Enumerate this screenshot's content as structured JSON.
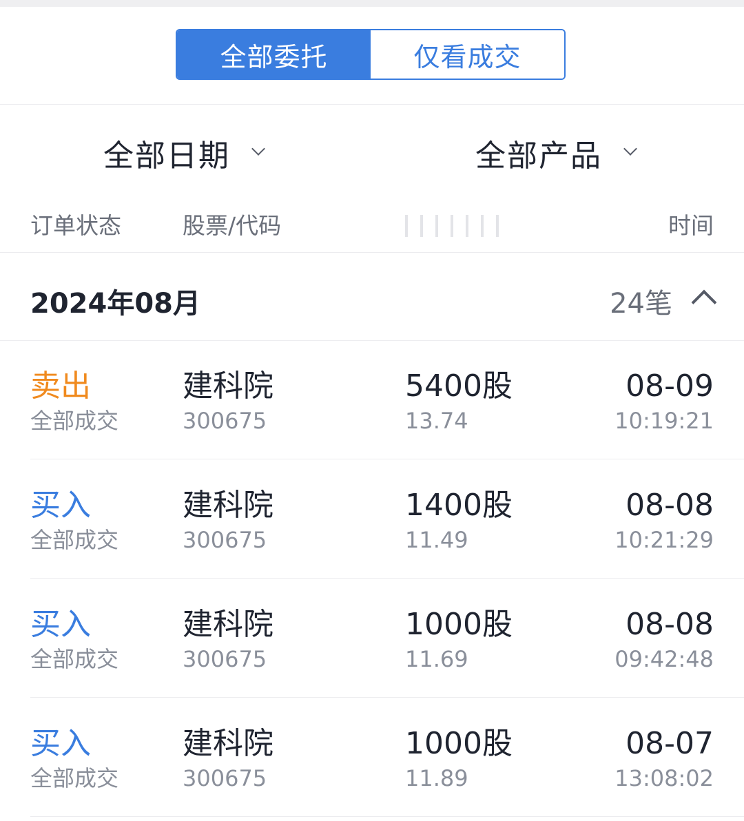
{
  "tabs": {
    "active_label": "全部委托",
    "inactive_label": "仅看成交"
  },
  "filters": {
    "date_label": "全部日期",
    "product_label": "全部产品"
  },
  "columns": {
    "status": "订单状态",
    "stock": "股票/代码",
    "time": "时间"
  },
  "month_group": {
    "title": "2024年08月",
    "count": "24笔"
  },
  "colors": {
    "accent": "#3a7ddf",
    "sell": "#f08a1e",
    "buy": "#3a7ddf"
  },
  "orders": [
    {
      "action": "卖出",
      "action_type": "sell",
      "status": "全部成交",
      "name": "建科院",
      "code": "300675",
      "qty": "5400股",
      "price": "13.74",
      "date": "08-09",
      "time": "10:19:21"
    },
    {
      "action": "买入",
      "action_type": "buy",
      "status": "全部成交",
      "name": "建科院",
      "code": "300675",
      "qty": "1400股",
      "price": "11.49",
      "date": "08-08",
      "time": "10:21:29"
    },
    {
      "action": "买入",
      "action_type": "buy",
      "status": "全部成交",
      "name": "建科院",
      "code": "300675",
      "qty": "1000股",
      "price": "11.69",
      "date": "08-08",
      "time": "09:42:48"
    },
    {
      "action": "买入",
      "action_type": "buy",
      "status": "全部成交",
      "name": "建科院",
      "code": "300675",
      "qty": "1000股",
      "price": "11.89",
      "date": "08-07",
      "time": "13:08:02"
    }
  ]
}
